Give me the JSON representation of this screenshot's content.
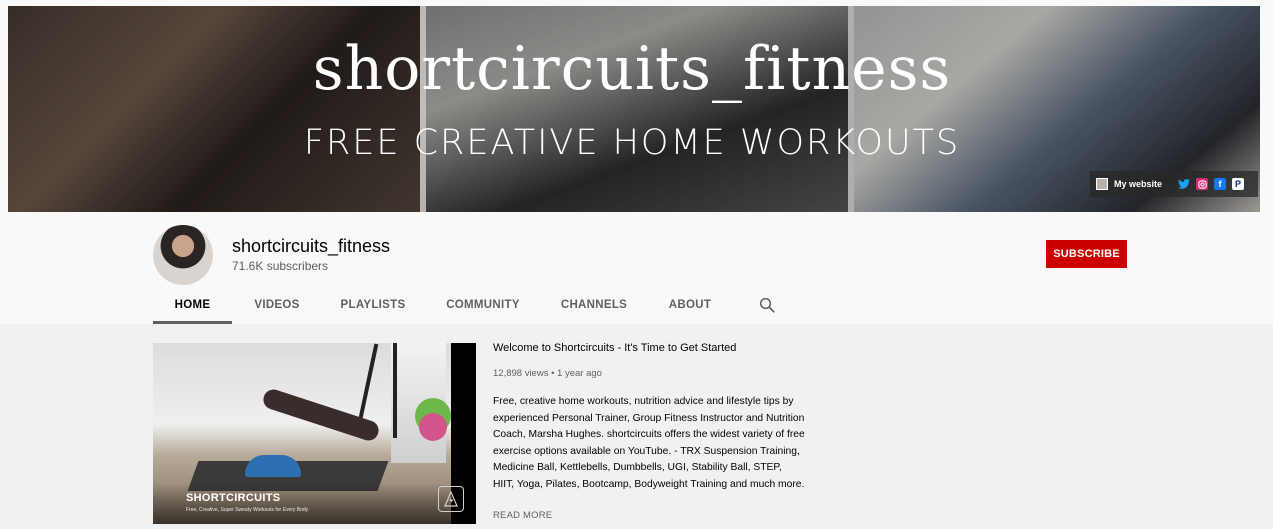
{
  "banner": {
    "title": "shortcircuits_fitness",
    "subtitle": "FREE CREATIVE HOME WORKOUTS",
    "links_label": "My website",
    "social_icons": [
      "twitter-icon",
      "instagram-icon",
      "facebook-icon",
      "paypal-icon"
    ]
  },
  "channel": {
    "name": "shortcircuits_fitness",
    "subscribers": "71.6K subscribers",
    "subscribe_label": "SUBSCRIBE"
  },
  "tabs": [
    {
      "label": "HOME",
      "active": true
    },
    {
      "label": "VIDEOS",
      "active": false
    },
    {
      "label": "PLAYLISTS",
      "active": false
    },
    {
      "label": "COMMUNITY",
      "active": false
    },
    {
      "label": "CHANNELS",
      "active": false
    },
    {
      "label": "ABOUT",
      "active": false
    }
  ],
  "featured_video": {
    "title": "Welcome to Shortcircuits - It's Time to Get Started",
    "meta": "12,898 views • 1 year ago",
    "description": "Free, creative home workouts, nutrition advice and lifestyle tips by experienced Personal Trainer, Group Fitness Instructor and Nutrition Coach, Marsha Hughes.  shortcircuits offers the widest variety of free exercise options available on YouTube. - TRX Suspension Training, Medicine Ball, Kettlebells, Dumbbells, UGI, Stability Ball, STEP, HIIT, Yoga, Pilates, Bootcamp, Bodyweight Training and much more.",
    "read_more": "READ MORE",
    "thumb_brand": "SHORTCIRCUITS",
    "thumb_tagline": "Free, Creative, Super Sweaty Workouts for Every Body"
  },
  "colors": {
    "subscribe": "#cc0000",
    "tab_active_underline": "#606060"
  }
}
